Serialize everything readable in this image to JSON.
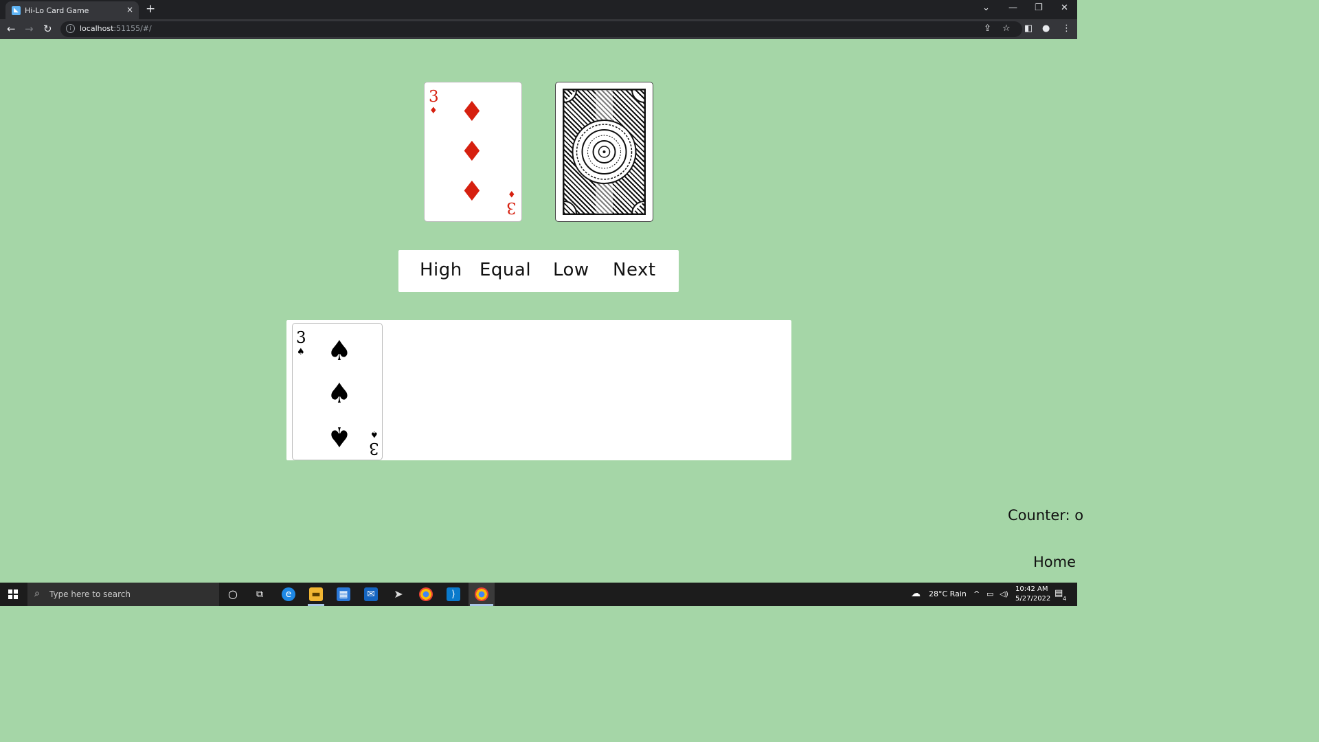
{
  "browser": {
    "tab_title": "Hi-Lo Card Game",
    "tab_close": "×",
    "new_tab": "+",
    "url_host": "localhost",
    "url_rest": ":51155/#/",
    "favicon": "flutter-icon"
  },
  "game": {
    "current_card": {
      "rank": "3",
      "suit": "♦",
      "suit_name": "diamonds",
      "color": "#d6200f"
    },
    "deck_card": {
      "state": "face-down"
    },
    "controls": [
      "High",
      "Equal",
      "Low",
      "Next"
    ],
    "hand": [
      {
        "rank": "3",
        "suit": "♠",
        "suit_name": "spades",
        "color": "#000000"
      }
    ],
    "counter_label": "Counter: o",
    "home_label": "Home"
  },
  "taskbar": {
    "search_placeholder": "Type here to search",
    "weather": "28°C  Rain",
    "time": "10:42 AM",
    "date": "5/27/2022",
    "notifications": "4"
  },
  "colors": {
    "page_background": "#a5d6a7",
    "red_suit": "#d6200f"
  }
}
